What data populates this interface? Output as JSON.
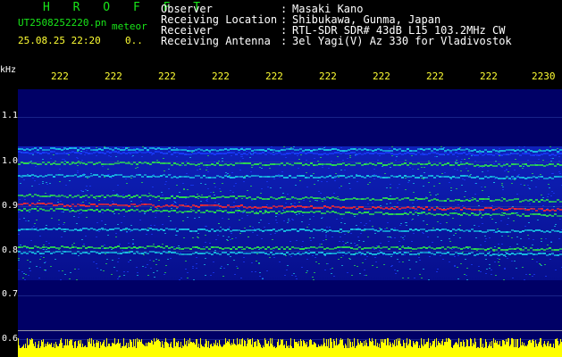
{
  "header": {
    "title": "H R O F F T",
    "filename": "UT2508252220.pn",
    "filename_suffix": "meteor",
    "datetime": "25.08.25 22:20",
    "datetime_extra": "0..",
    "info": [
      {
        "label": "Observer",
        "value": "Masaki Kano"
      },
      {
        "label": "Receiving Location",
        "value": "Shibukawa, Gunma, Japan"
      },
      {
        "label": "Receiver",
        "value": "RTL-SDR SDR# 43dB L15 103.2MHz CW"
      },
      {
        "label": "Receiving Antenna",
        "value": "3el Yagi(V) Az 330 for Vladivostok"
      }
    ],
    "colon": ":"
  },
  "axis": {
    "unit": "kHz",
    "time_ticks": [
      "222",
      "222",
      "222",
      "222",
      "222",
      "222",
      "222",
      "222",
      "222",
      "2230"
    ],
    "freq_ticks": [
      "1.1",
      "1.0",
      "0.9",
      "0.8",
      "0.7",
      "0.6"
    ]
  },
  "colors": {
    "background": "#000000",
    "header_green": "#19e619",
    "header_white": "#ffffff",
    "tick_yellow": "#ffff33",
    "spectrogram_bg": "#000066",
    "signal_blue": "#1a3cff",
    "signal_cyan": "#19c8e6",
    "signal_green": "#2ee64a",
    "signal_red": "#ff2a2a",
    "meteor_bar_yellow": "#ffff00"
  }
}
